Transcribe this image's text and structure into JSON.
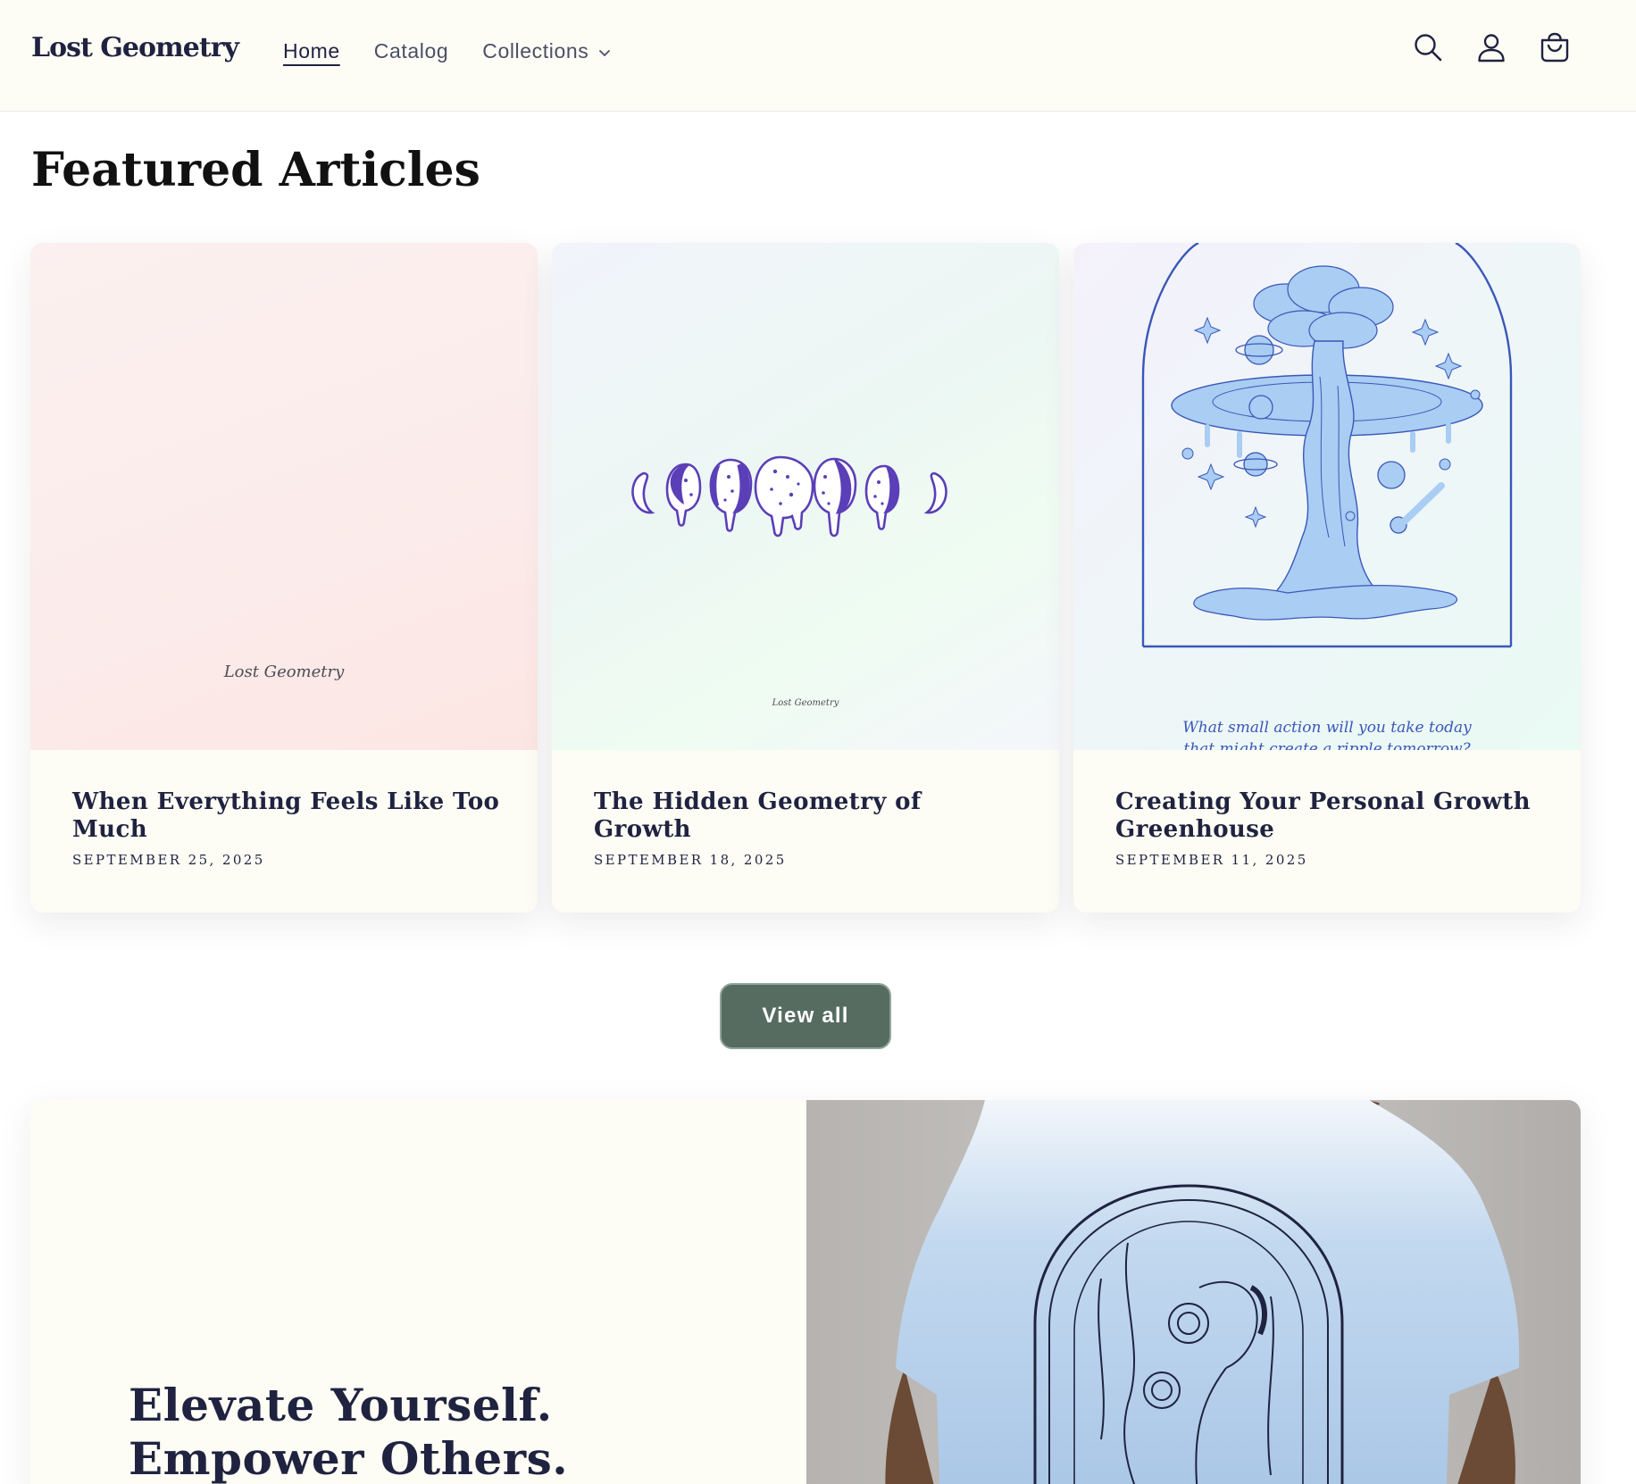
{
  "header": {
    "logo": "Lost Geometry",
    "nav": [
      {
        "label": "Home",
        "active": true
      },
      {
        "label": "Catalog",
        "active": false
      },
      {
        "label": "Collections",
        "active": false
      }
    ],
    "icons": [
      "search-icon",
      "account-icon",
      "cart-icon"
    ]
  },
  "featured": {
    "title": "Featured Articles",
    "articles": [
      {
        "title": "When Everything Feels Like Too Much",
        "date": "SEPTEMBER 25, 2025",
        "image_text": "Lost Geometry"
      },
      {
        "title": "The Hidden Geometry of Growth",
        "date": "SEPTEMBER 18, 2025",
        "image_text": "Lost Geometry"
      },
      {
        "title": "Creating Your Personal Growth Greenhouse",
        "date": "SEPTEMBER 11, 2025",
        "image_text": "What small action will you take today",
        "image_text_cut": "that might create a ripple tomorrow?"
      }
    ],
    "view_all_label": "View all"
  },
  "banner": {
    "heading": "Elevate Yourself. Empower Others."
  },
  "colors": {
    "header_bg": "#fdfcf5",
    "text_primary": "#1f2340",
    "button_bg": "#566c61",
    "moon_purple": "#5b3fb8",
    "illustration_blue": "#a9cdf3"
  }
}
